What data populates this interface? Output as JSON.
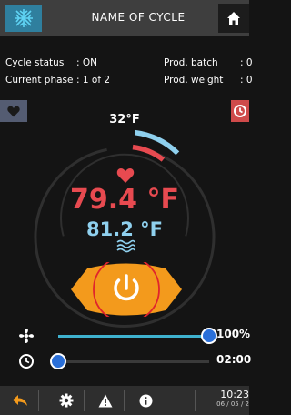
{
  "header": {
    "cycle_name": "NAME OF CYCLE"
  },
  "info": {
    "cycle_status_label": "Cycle status",
    "cycle_status_value": ": ON",
    "current_phase_label": "Current phase",
    "current_phase_value": ": 1 of 2",
    "prod_batch_label": "Prod. batch",
    "prod_batch_value": ": 0",
    "prod_weight_label": "Prod. weight",
    "prod_weight_value": ": 0"
  },
  "gauge": {
    "setpoint": "32°F",
    "main_temperature": "79.4 °F",
    "probe_temperature": "81.2 °F"
  },
  "sliders": {
    "fan": {
      "value_text": "100%",
      "level": 1.0
    },
    "time": {
      "value_text": "02:00",
      "level": 0.0
    }
  },
  "clock": {
    "time": "10:23",
    "date": "06 / 05 / 2"
  },
  "colors": {
    "accent_blue": "#3fb2cf",
    "hot_red": "#e74a50",
    "probe_blue": "#8fd0ee",
    "start_orange": "#f39a1c",
    "highlight_red": "#e0242c"
  },
  "icons": [
    "snowflake-grid-icon",
    "home-icon",
    "heart-icon",
    "timer-icon",
    "fan-icon",
    "clock-icon",
    "back-arrow-icon",
    "gear-icon",
    "warning-icon",
    "info-icon",
    "power-icon",
    "waves-icon"
  ]
}
